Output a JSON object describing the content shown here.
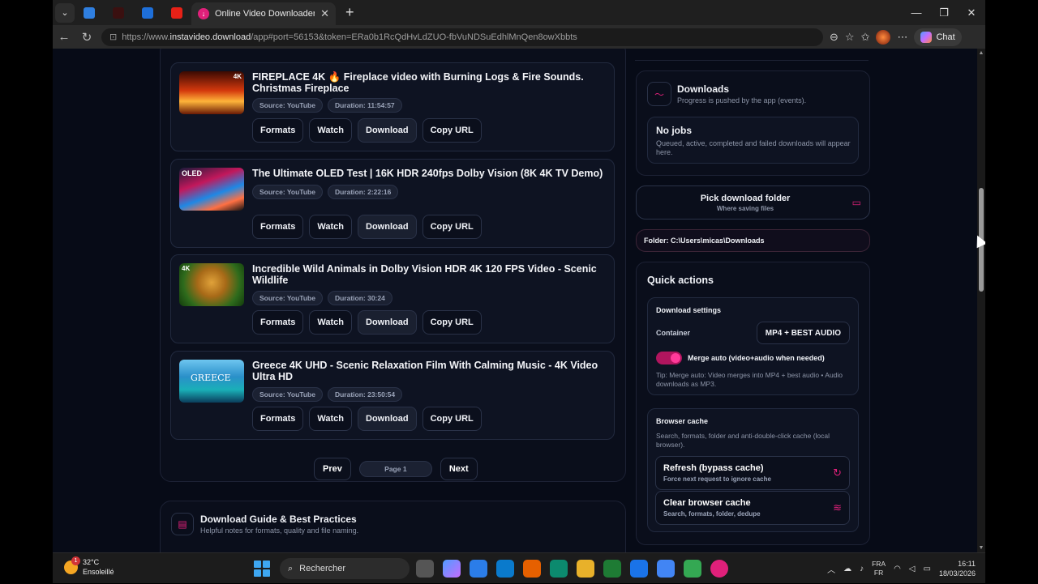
{
  "browser": {
    "active_tab_title": "Online Video Downloader",
    "url_scheme": "https://www.",
    "url_host": "instavideo.download",
    "url_rest": "/app#port=56153&token=ERa0b1RcQdHvLdZUO-fbVuNDSuEdhlMnQen8owXbbts",
    "chat_label": "Chat"
  },
  "videos": [
    {
      "title": "FIREPLACE 4K 🔥 Fireplace video with Burning Logs & Fire Sounds. Christmas Fireplace",
      "source": "Source: YouTube",
      "duration": "Duration: 11:54:57",
      "thumb_badge": "4K"
    },
    {
      "title": "The Ultimate OLED Test | 16K HDR 240fps Dolby Vision (8K 4K TV Demo)",
      "source": "Source: YouTube",
      "duration": "Duration: 2:22:16",
      "thumb_badge": "OLED"
    },
    {
      "title": "Incredible Wild Animals in Dolby Vision HDR 4K 120 FPS Video - Scenic Wildlife",
      "source": "Source: YouTube",
      "duration": "Duration: 30:24",
      "thumb_badge": "4K"
    },
    {
      "title": "Greece 4K UHD - Scenic Relaxation Film With Calming Music - 4K Video Ultra HD",
      "source": "Source: YouTube",
      "duration": "Duration: 23:50:54",
      "thumb_badge": "GREECE"
    }
  ],
  "card_buttons": {
    "formats": "Formats",
    "watch": "Watch",
    "download": "Download",
    "copy_url": "Copy URL"
  },
  "pager": {
    "prev": "Prev",
    "page": "Page 1",
    "next": "Next"
  },
  "guide": {
    "title": "Download Guide & Best Practices",
    "subtitle": "Helpful notes for formats, quality and file naming."
  },
  "downloads": {
    "title": "Downloads",
    "subtitle": "Progress is pushed by the app (events).",
    "empty_title": "No jobs",
    "empty_text": "Queued, active, completed and failed downloads will appear here."
  },
  "folder": {
    "pick_label": "Pick download folder",
    "pick_sub": "Where saving files",
    "path": "Folder: C:\\Users\\micas\\Downloads"
  },
  "quick_actions": {
    "title": "Quick actions",
    "settings_title": "Download settings",
    "container_label": "Container",
    "container_value": "MP4 + BEST AUDIO",
    "merge_label": "Merge auto (video+audio when needed)",
    "merge_on": true,
    "tip": "Tip: Merge auto: Video merges into MP4 + best audio • Audio downloads as MP3.",
    "cache_title": "Browser cache",
    "cache_text": "Search, formats, folder and anti-double-click cache (local browser).",
    "refresh_label": "Refresh (bypass cache)",
    "refresh_sub": "Force next request to ignore cache",
    "clear_label": "Clear browser cache",
    "clear_sub": "Search, formats, folder, dedupe"
  },
  "taskbar": {
    "temp": "32°C",
    "weather": "Ensoleillé",
    "weather_badge": "1",
    "search": "Rechercher",
    "lang1": "FRA",
    "lang2": "FR",
    "time": "16:11",
    "date": "18/03/2026"
  },
  "colors": {
    "accent": "#e0207a",
    "page_bg": "#070b17",
    "card_bg": "#0e1322"
  }
}
